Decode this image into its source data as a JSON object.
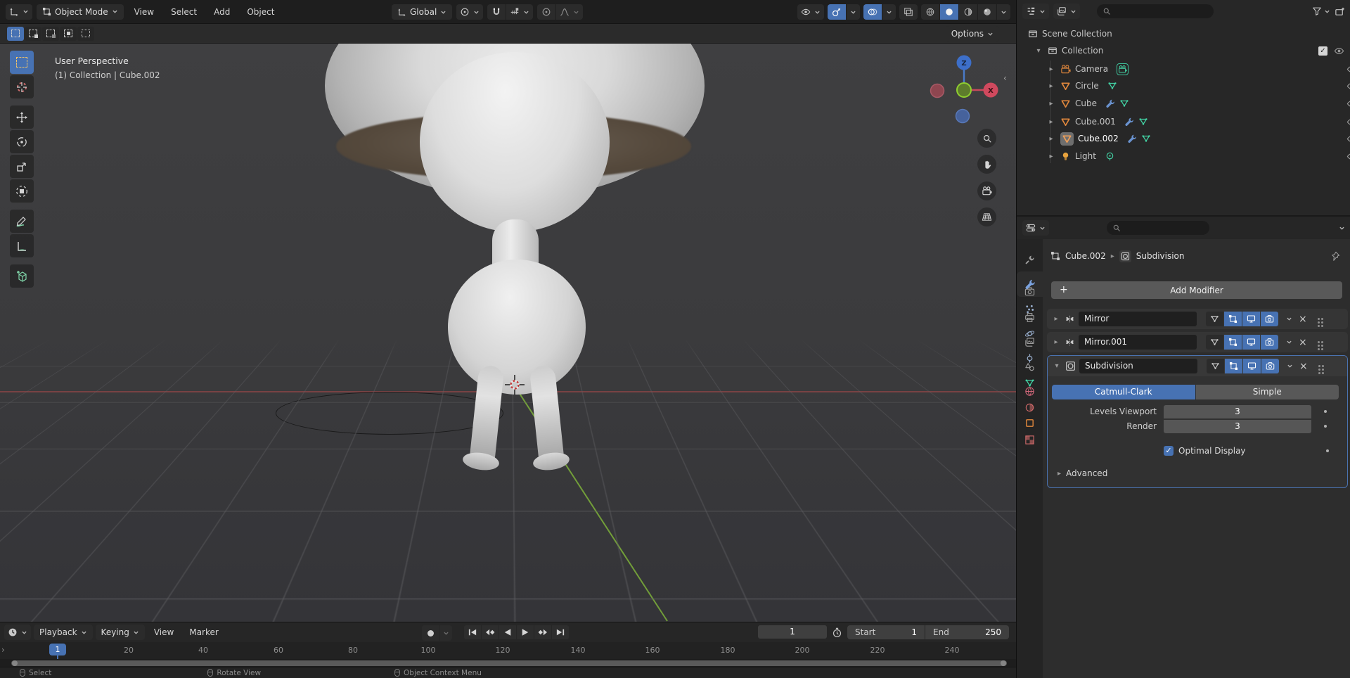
{
  "colors": {
    "accent": "#4772b3",
    "object_orange": "#e0873c",
    "data_green": "#43d3a5",
    "modifier_blue": "#6a93d0",
    "material_red": "#d06a6a"
  },
  "header": {
    "mode_label": "Object Mode",
    "menus": [
      "View",
      "Select",
      "Add",
      "Object"
    ],
    "orientation_label": "Global"
  },
  "tool_settings": {
    "options_label": "Options"
  },
  "toolbar": {
    "tools": [
      "select-box",
      "cursor",
      "move",
      "rotate",
      "scale",
      "transform",
      "annotate",
      "measure",
      "add-cube"
    ]
  },
  "viewport": {
    "overlay_title": "User Perspective",
    "overlay_subtitle": "(1) Collection | Cube.002",
    "gizmo": {
      "z_label": "Z",
      "x_label": "X"
    }
  },
  "outliner": {
    "scene_label": "Scene Collection",
    "collection_label": "Collection",
    "items": [
      {
        "label": "Camera",
        "type": "camera"
      },
      {
        "label": "Circle",
        "type": "mesh"
      },
      {
        "label": "Cube",
        "type": "mesh"
      },
      {
        "label": "Cube.001",
        "type": "mesh"
      },
      {
        "label": "Cube.002",
        "type": "mesh",
        "active": true
      },
      {
        "label": "Light",
        "type": "light"
      }
    ]
  },
  "properties": {
    "breadcrumb": {
      "object": "Cube.002",
      "modifier": "Subdivision"
    },
    "add_modifier_label": "Add Modifier",
    "modifiers": [
      {
        "name": "Mirror",
        "type": "mirror",
        "expanded": false
      },
      {
        "name": "Mirror.001",
        "type": "mirror",
        "expanded": false
      },
      {
        "name": "Subdivision",
        "type": "subsurf",
        "expanded": true
      }
    ],
    "subdivision": {
      "type_options": [
        "Catmull-Clark",
        "Simple"
      ],
      "active_type": "Catmull-Clark",
      "levels_viewport_label": "Levels Viewport",
      "levels_viewport_value": "3",
      "render_label": "Render",
      "render_value": "3",
      "optimal_display_label": "Optimal Display",
      "optimal_display_checked": true,
      "advanced_label": "Advanced"
    }
  },
  "timeline": {
    "menus": {
      "playback": "Playback",
      "keying": "Keying",
      "view": "View",
      "marker": "Marker"
    },
    "current_frame": "1",
    "start_label": "Start",
    "start_value": "1",
    "end_label": "End",
    "end_value": "250",
    "playhead_frame": "1",
    "ruler_ticks": [
      "20",
      "40",
      "60",
      "80",
      "100",
      "120",
      "140",
      "160",
      "180",
      "200",
      "220",
      "240"
    ]
  },
  "statusbar": {
    "hints": [
      "Select",
      "Rotate View",
      "Object Context Menu"
    ]
  }
}
